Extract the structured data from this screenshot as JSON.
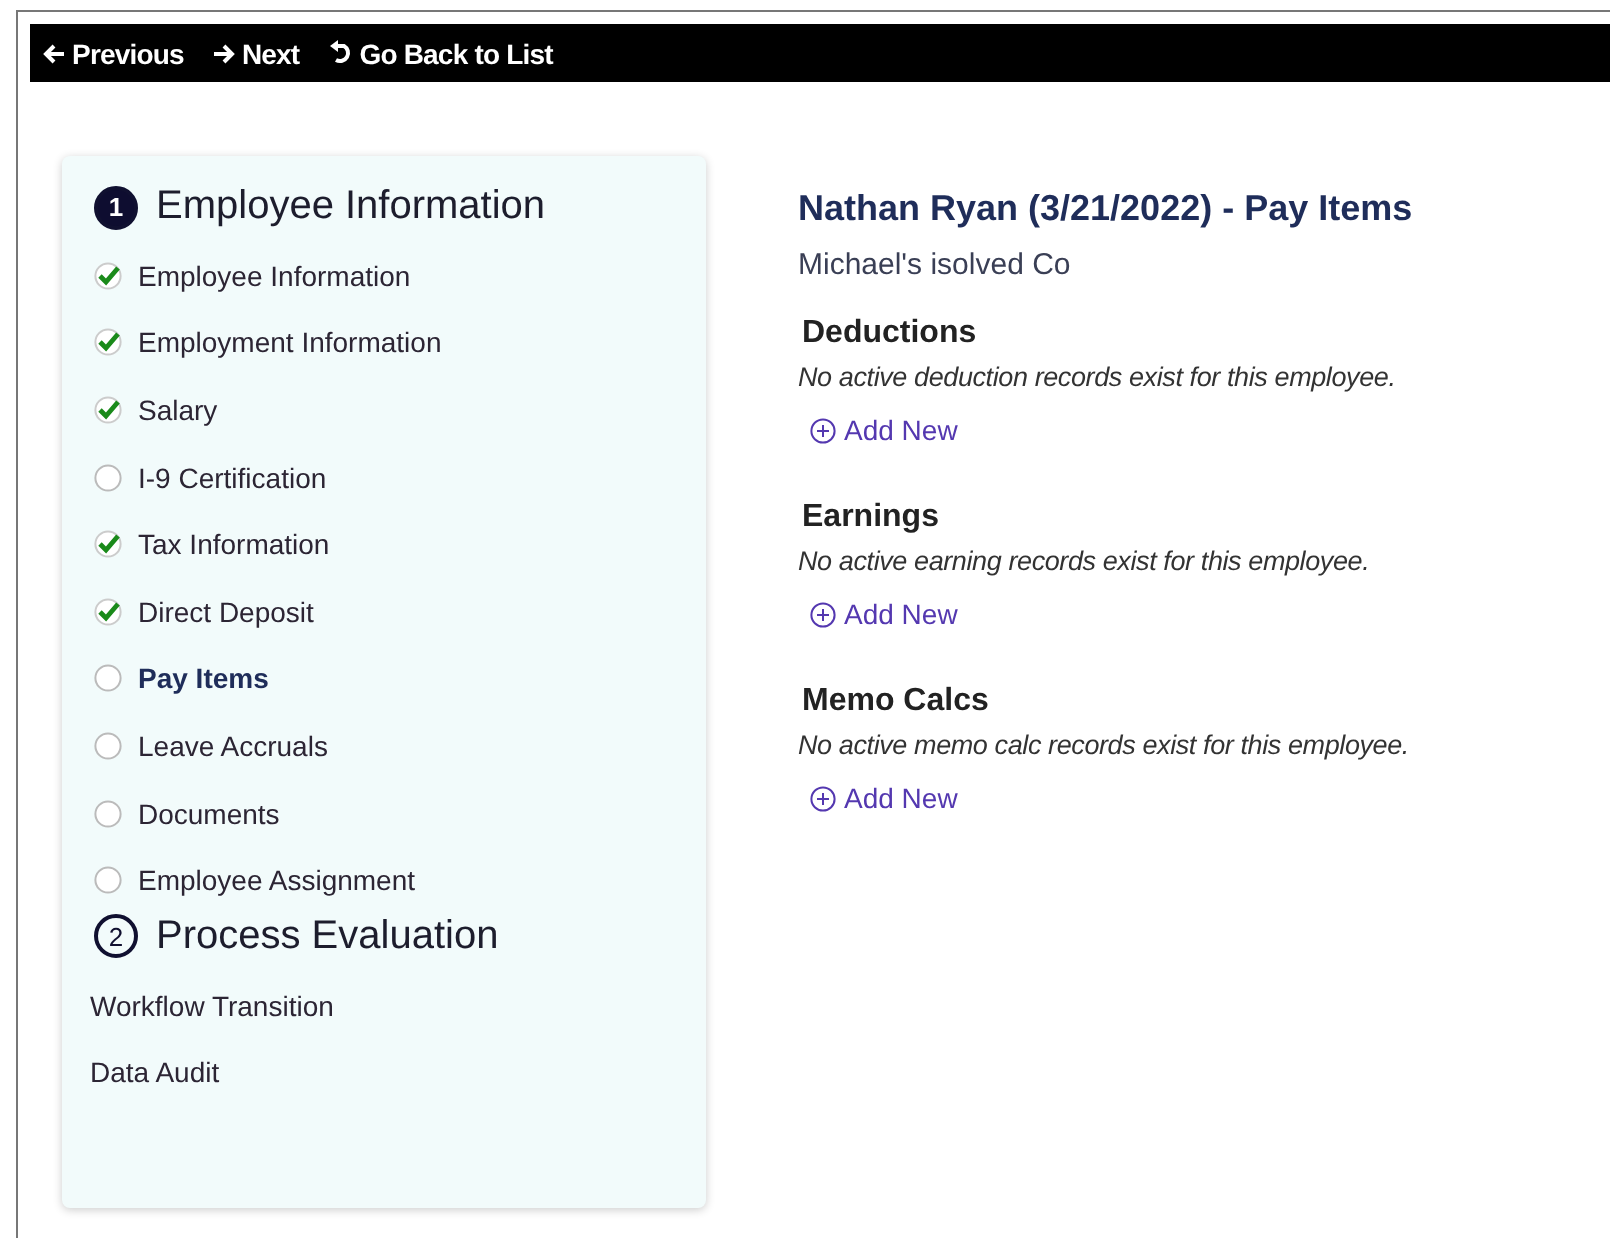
{
  "toolbar": {
    "buttons": [
      {
        "kind": "back",
        "label": "Previous"
      },
      {
        "kind": "forward",
        "label": "Next"
      },
      {
        "kind": "undo",
        "label": "Go Back to List"
      }
    ]
  },
  "steps": [
    {
      "number": "1",
      "title": "Employee Information",
      "selected": true,
      "items": [
        {
          "label": "Employee Information",
          "checked": true,
          "selected": false
        },
        {
          "label": "Employment Information",
          "checked": true,
          "selected": false
        },
        {
          "label": "Salary",
          "checked": true,
          "selected": false
        },
        {
          "label": "I-9 Certification",
          "checked": false,
          "selected": false
        },
        {
          "label": "Tax Information",
          "checked": true,
          "selected": false
        },
        {
          "label": "Direct Deposit",
          "checked": true,
          "selected": false
        },
        {
          "label": "Pay Items",
          "checked": false,
          "selected": true
        },
        {
          "label": "Leave Accruals",
          "checked": false,
          "selected": false
        },
        {
          "label": "Documents",
          "checked": false,
          "selected": false
        },
        {
          "label": "Employee Assignment",
          "checked": false,
          "selected": false
        }
      ]
    },
    {
      "number": "2",
      "title": "Process Evaluation",
      "selected": false,
      "items": [
        {
          "label": "Workflow Transition",
          "selected": false
        },
        {
          "label": "Data Audit",
          "selected": false
        }
      ]
    }
  ],
  "main": {
    "title": "Nathan Ryan (3/21/2022) - Pay Items",
    "subtitle": "Michael's isolved Co",
    "sections": [
      {
        "title": "Deductions",
        "message": "No active deduction records exist for this employee.",
        "action": "Add New"
      },
      {
        "title": "Earnings",
        "message": "No active earning records exist for this employee.",
        "action": "Add New"
      },
      {
        "title": "Memo Calcs",
        "message": "No active memo calc records exist for this employee.",
        "action": "Add New"
      }
    ]
  }
}
